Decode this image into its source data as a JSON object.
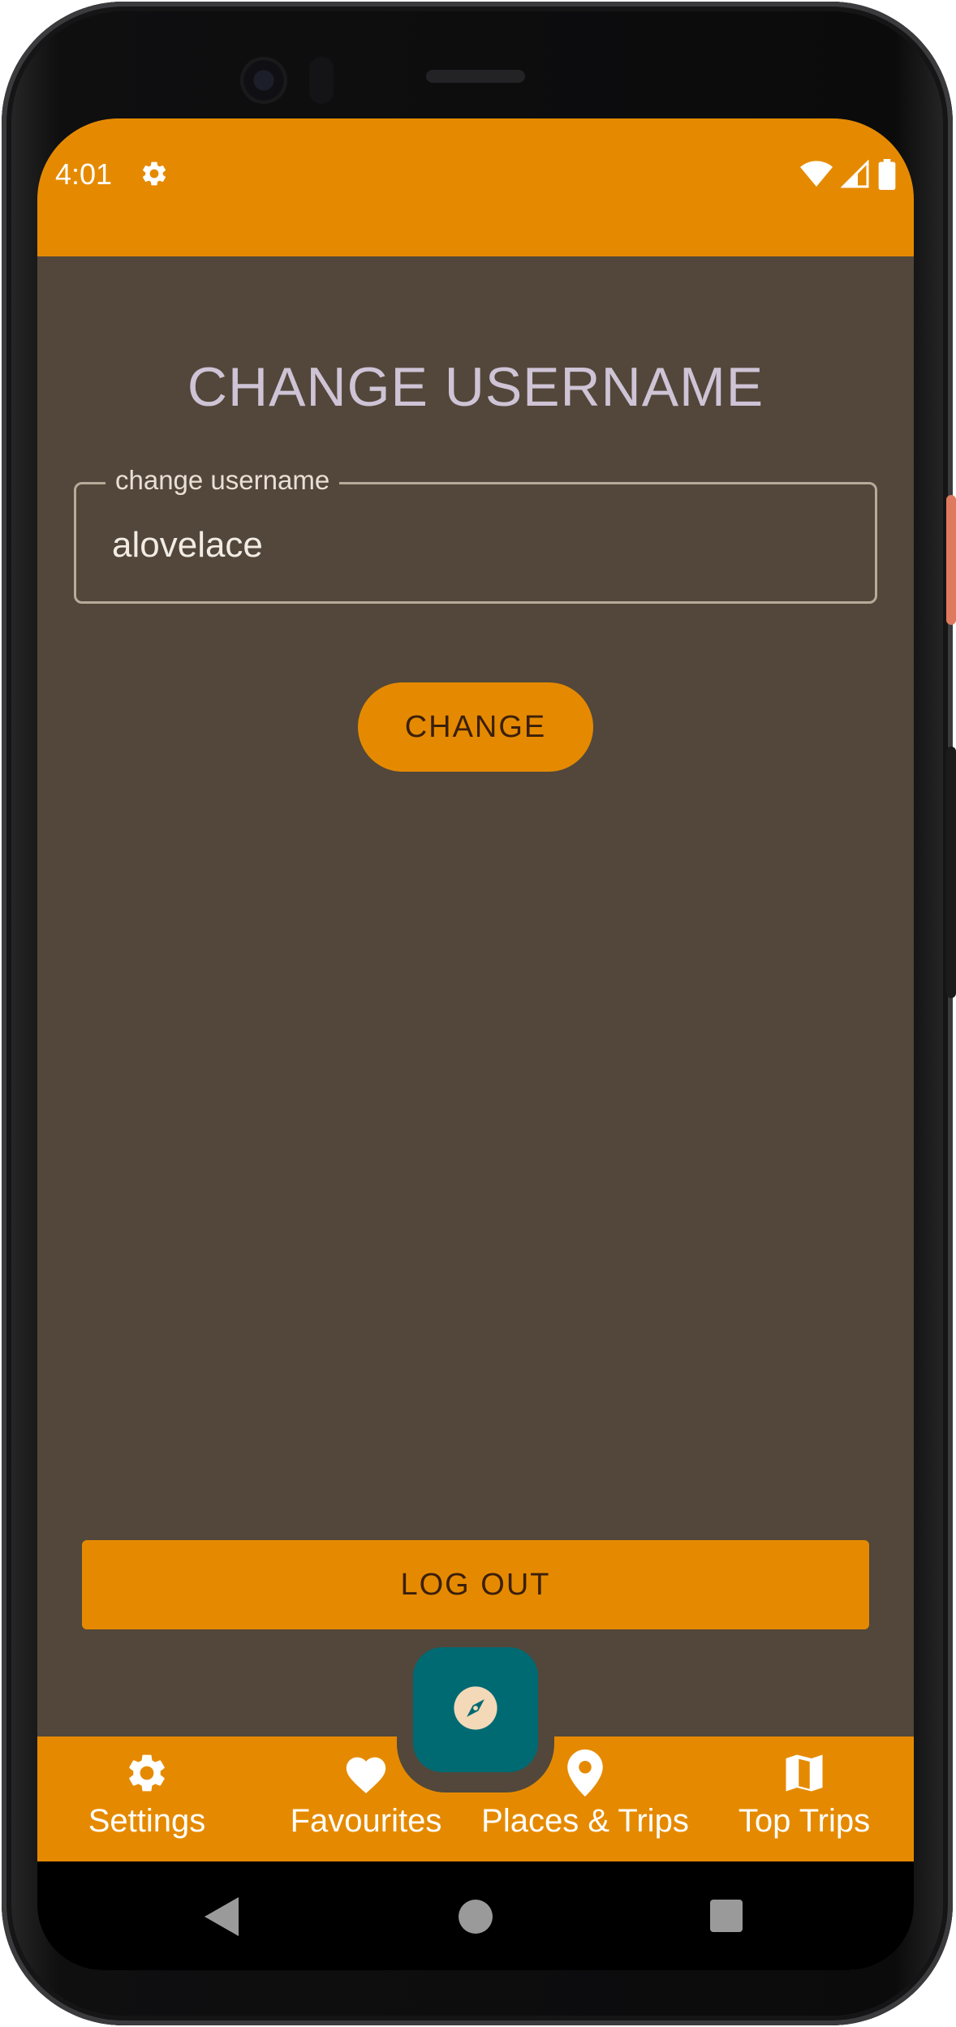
{
  "status_bar": {
    "time": "4:01",
    "icons": [
      "gear-icon",
      "wifi-icon",
      "signal-icon",
      "battery-icon"
    ]
  },
  "screen": {
    "title": "CHANGE USERNAME",
    "username_field": {
      "label": "change username",
      "value": "alovelace"
    },
    "change_button": "CHANGE",
    "logout_button": "LOG OUT"
  },
  "fab": {
    "icon": "compass-icon"
  },
  "bottom_nav": {
    "items": [
      {
        "label": "Settings",
        "icon": "gear-icon"
      },
      {
        "label": "Favourites",
        "icon": "heart-icon"
      },
      {
        "label": "Places & Trips",
        "icon": "location-pin-icon"
      },
      {
        "label": "Top Trips",
        "icon": "map-icon"
      }
    ]
  },
  "system_nav": [
    "back-icon",
    "home-icon",
    "recents-icon"
  ],
  "colors": {
    "primary_orange": "#e58a00",
    "background": "#52473a",
    "fab": "#006a73",
    "title_text": "#cfc4d6",
    "button_text": "#3b1f0c"
  }
}
